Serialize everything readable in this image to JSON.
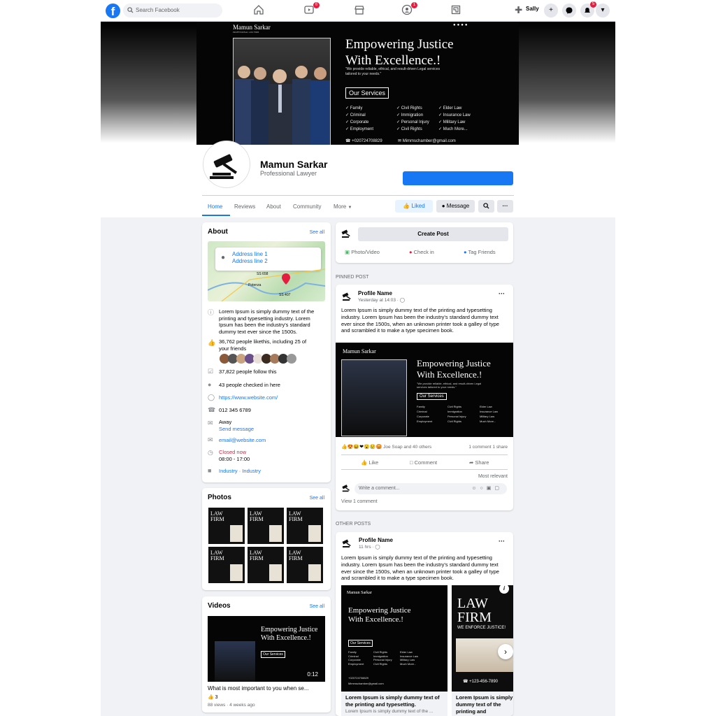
{
  "topbar": {
    "search_placeholder": "Search Facebook",
    "user_name": "Sally",
    "badges": {
      "video": "6",
      "groups": "1",
      "notifications": "5"
    }
  },
  "cover": {
    "brand": "Mamun Sarkar",
    "brand_sub": "PROFESSIONAL LAW FIRM",
    "headline_1": "Empowering Justice",
    "headline_2": "With Excellence.!",
    "tagline": "\"We provide reliable, ethical, and result-driven Legal services tailored to your needs.\"",
    "services_button": "Our Services",
    "services_col1": [
      "Family",
      "Criminal",
      "Corporate",
      "Employment"
    ],
    "services_col2": [
      "Civil Rights",
      "Immigration",
      "Personal Injury",
      "Civil Rights"
    ],
    "services_col3": [
      "Elder Law",
      "Insurance Law",
      "Military Law",
      "Much More..."
    ],
    "phone": "+020724708829",
    "email": "Mimmschamber@gmail.com"
  },
  "profile": {
    "name": "Mamun Sarkar",
    "tagline": "Professional Lawyer"
  },
  "tabs": [
    "Home",
    "Reviews",
    "About",
    "Community",
    "More"
  ],
  "actions": {
    "liked": "Liked",
    "message": "Message"
  },
  "about": {
    "title": "About",
    "see_all": "See all",
    "address_1": "Address line 1",
    "address_2": "Address line 2",
    "map_labels": [
      "Potenza",
      "SS 407",
      "SS 658"
    ],
    "description": "Lorem Ipsum is simply dummy text of the printing and typesetting industry. Lorem Ipsum has been the industry's standard dummy text ever since the 1500s.",
    "likes": "36,762 people likethis, including 25 of your friends",
    "followers": "37,822 people follow this",
    "checkins": "43 people checked in here",
    "website": "https://www.website.com/",
    "phone": "012 345 6789",
    "status": "Away",
    "send_message": "Send message",
    "email": "email@website.com",
    "hours_status": "Closed now",
    "hours": "08:00 - 17:00",
    "category": "Industry · Industry"
  },
  "photos": {
    "title": "Photos",
    "see_all": "See all",
    "thumb_text": [
      "LAW",
      "FIRM"
    ]
  },
  "videos": {
    "title": "Videos",
    "see_all": "See all",
    "duration": "0:12",
    "caption": "What is most important to you when se...",
    "reactions": "3",
    "meta": "88 views · 4 weeks ago"
  },
  "composer": {
    "create_post": "Create Post",
    "photo_video": "Photo/Video",
    "check_in": "Check in",
    "tag_friends": "Tag Friends"
  },
  "pinned": {
    "section_label": "PINNED POST",
    "author": "Profile Name",
    "time": "Yesterday at 14:03 · ",
    "text": "Lorem Ipsum is simply dummy text of the printing and typesetting industry. Lorem Ipsum has been the industry's standard dummy text ever since the 1500s, when an unknown printer took a galley of type and scrambled it to make a type specimen book.",
    "reactions": "Joe Soap and 40 others",
    "comments_shares": "1 comment 1 share",
    "like": "Like",
    "comment": "Comment",
    "share": "Share",
    "sort": "Most relevant",
    "comment_placeholder": "Write a comment...",
    "view_comments": "View 1 comment"
  },
  "other": {
    "section_label": "OTHER POSTS",
    "author": "Profile Name",
    "time": "11 hrs · ",
    "text": "Lorem Ipsum is simply dummy text of the printing and typesetting industry. Lorem Ipsum has been the industry's standard dummy text ever since the 1500s, when an unknown printer took a galley of type and scrambled it to make a type specimen book.",
    "card1_caption": "Lorem Ipsum is simply dummy text of the printing and typesetting.",
    "card1_sub": "Lorem Ipsum is simply dummy text of the ...",
    "card2_caption": "Lorem Ipsum is simply dummy text of the printing and typesetting",
    "card2_title_1": "LAW",
    "card2_title_2": "FIRM",
    "card2_sub": "WE ENFORCE JUSTICE!",
    "card2_phone": "+123-456-7890"
  },
  "colors": {
    "brand": "#1877f2",
    "closed": "#e41e3f",
    "background": "#f0f2f5"
  }
}
